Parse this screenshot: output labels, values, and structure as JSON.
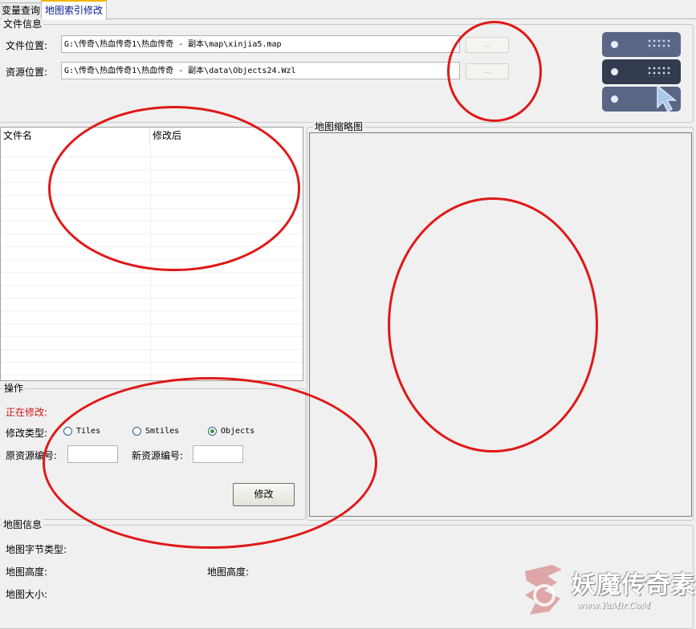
{
  "tabs": [
    {
      "label": "变量查询",
      "active": false
    },
    {
      "label": "地图索引修改",
      "active": true
    }
  ],
  "file_info": {
    "title": "文件信息",
    "file_location_label": "文件位置:",
    "file_location_value": "G:\\传奇\\热血传奇1\\热血传奇 - 副本\\map\\xinjia5.map",
    "resource_location_label": "资源位置:",
    "resource_location_value": "G:\\传奇\\热血传奇1\\热血传奇 - 副本\\data\\Objects24.Wzl",
    "browse_label": "..."
  },
  "list": {
    "columns": [
      "文件名",
      "修改后"
    ],
    "rows": []
  },
  "preview": {
    "title": "地图缩略图"
  },
  "operation": {
    "title": "操作",
    "status_label": "正在修改:",
    "modify_type_label": "修改类型:",
    "radio_options": [
      {
        "label": "Tiles",
        "checked": false
      },
      {
        "label": "Smtiles",
        "checked": false
      },
      {
        "label": "Objects",
        "checked": true
      }
    ],
    "original_id_label": "原资源编号:",
    "new_id_label": "新资源编号:",
    "modify_button": "修改"
  },
  "map_info": {
    "title": "地图信息",
    "byte_type_label": "地图字节类型:",
    "height_label_1": "地图高度:",
    "height_label_2": "地图高度:",
    "size_label": "地图大小:"
  },
  "watermark": {
    "text": "妖魔传奇素材",
    "url": "www.YaMir.CoM"
  },
  "colors": {
    "accent_tab": "#f5b400",
    "status_red": "#d01010",
    "annotation_red": "#e01818",
    "server_top": "#5a6685",
    "server_mid": "#323c4e",
    "server_bottom": "#5a6685",
    "cursor_blue": "#a8c8ec"
  }
}
